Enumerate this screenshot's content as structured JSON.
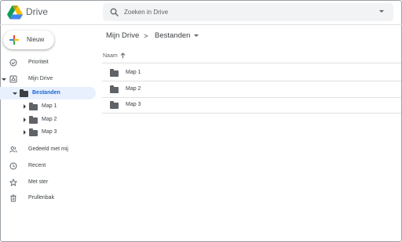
{
  "header": {
    "app_title": "Drive",
    "search_placeholder": "Zoeken in Drive",
    "logo_icon": "google-drive-logo",
    "search_icon": "search-icon",
    "options_icon": "chevron-down-icon"
  },
  "new_button": {
    "label": "Nieuw",
    "icon": "plus-icon"
  },
  "sidebar": {
    "priority": {
      "label": "Prioriteit",
      "icon": "check-circle-icon"
    },
    "my_drive": {
      "label": "Mijn Drive",
      "icon": "drive-icon",
      "expanded": true
    },
    "bestanden": {
      "label": "Bestanden",
      "icon": "folder-icon",
      "expanded": true,
      "selected": true
    },
    "subfolders": [
      {
        "label": "Map 1",
        "icon": "folder-icon"
      },
      {
        "label": "Map 2",
        "icon": "folder-icon"
      },
      {
        "label": "Map 3",
        "icon": "folder-icon"
      }
    ],
    "shared": {
      "label": "Gedeeld met mij",
      "icon": "people-icon"
    },
    "recent": {
      "label": "Recent",
      "icon": "clock-icon"
    },
    "starred": {
      "label": "Met ster",
      "icon": "star-icon"
    },
    "trash": {
      "label": "Prullenbak",
      "icon": "trash-icon"
    }
  },
  "breadcrumb": {
    "root": "Mijn Drive",
    "separator": ">",
    "current": "Bestanden",
    "dropdown_icon": "caret-down-icon"
  },
  "file_list": {
    "column_name": "Naam",
    "sort_icon": "arrow-up-icon",
    "rows": [
      {
        "name": "Map 1",
        "icon": "folder-icon"
      },
      {
        "name": "Map 2",
        "icon": "folder-icon"
      },
      {
        "name": "Map 3",
        "icon": "folder-icon"
      }
    ]
  },
  "colors": {
    "selected_bg": "#e8f0fe",
    "selected_text": "#1967d2",
    "search_bg": "#f1f3f4",
    "text": "#3c4043",
    "icon": "#5f6368",
    "divider": "#e0e0e0"
  }
}
